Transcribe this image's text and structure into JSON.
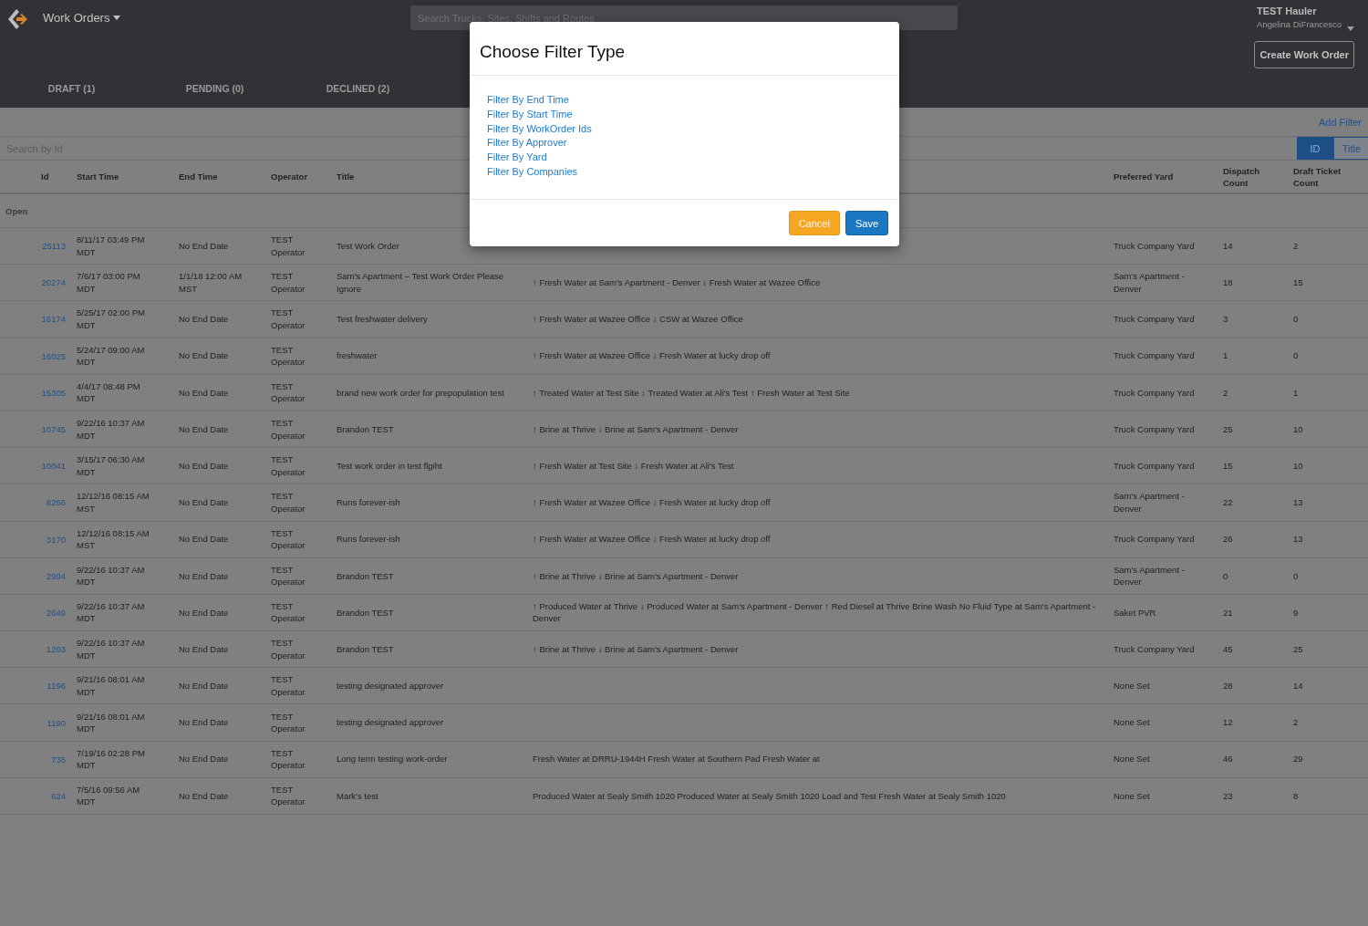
{
  "app": {
    "title": "Work Orders",
    "search_placeholder": "Search Trucks, Sites, Shifts and Routes",
    "company": "TEST Hauler",
    "user": "Angelina DiFrancesco",
    "create_button": "Create Work Order"
  },
  "tabs": [
    {
      "label": "DRAFT (1)",
      "selected": false
    },
    {
      "label": "PENDING (0)",
      "selected": false
    },
    {
      "label": "DECLINED (2)",
      "selected": false
    }
  ],
  "add_filter": "Add Filter",
  "search": {
    "placeholder": "Search by Id",
    "modes": [
      {
        "label": "ID",
        "selected": true
      },
      {
        "label": "Title",
        "selected": false
      }
    ]
  },
  "table": {
    "columns": [
      "Id",
      "Start Time",
      "End Time",
      "Operator",
      "Title",
      "Preferred Yard",
      "Dispatch Count",
      "Draft Ticket Count"
    ],
    "group": "Open",
    "rows": [
      {
        "id": "25113",
        "start": "8/11/17 03:49 PM MDT",
        "end": "No End Date",
        "operator": "TEST Operator",
        "title": "Test Work Order",
        "yard": "Truck Company Yard",
        "dispatch": "14",
        "draft": "2"
      },
      {
        "id": "20274",
        "start": "7/6/17 03:00 PM MDT",
        "end": "1/1/18 12:00 AM MST",
        "operator": "TEST Operator",
        "title": "Sam's Apartment – Test Work Order Please Ignore",
        "route": "↑ Fresh Water at Sam's Apartment - Denver ↓ Fresh Water at Wazee Office",
        "yard": "Sam's Apartment - Denver",
        "dispatch": "18",
        "draft": "15"
      },
      {
        "id": "16174",
        "start": "5/25/17 02:00 PM MDT",
        "end": "No End Date",
        "operator": "TEST Operator",
        "title": "Test freshwater delivery",
        "route": "↑ Fresh Water at Wazee Office ↓ CSW at Wazee Office",
        "yard": "Truck Company Yard",
        "dispatch": "3",
        "draft": "0"
      },
      {
        "id": "16025",
        "start": "5/24/17 09:00 AM MDT",
        "end": "No End Date",
        "operator": "TEST Operator",
        "title": "freshwater",
        "route": "↑ Fresh Water at Wazee Office ↓ Fresh Water at lucky drop off",
        "yard": "Truck Company Yard",
        "dispatch": "1",
        "draft": "0"
      },
      {
        "id": "15305",
        "start": "4/4/17 08:48 PM MDT",
        "end": "No End Date",
        "operator": "TEST Operator",
        "title": "brand new work order for prepopulation test",
        "route": "↑ Treated Water at Test Site ↓ Treated Water at Ali's Test ↑ Fresh Water at Test Site",
        "yard": "Truck Company Yard",
        "dispatch": "2",
        "draft": "1"
      },
      {
        "id": "10745",
        "start": "9/22/16 10:37 AM MDT",
        "end": "No End Date",
        "operator": "TEST Operator",
        "title": "Brandon TEST",
        "route": "↑ Brine at Thrive ↓ Brine at Sam's Apartment - Denver",
        "yard": "Truck Company Yard",
        "dispatch": "25",
        "draft": "10"
      },
      {
        "id": "10041",
        "start": "3/15/17 06:30 AM MDT",
        "end": "No End Date",
        "operator": "TEST Operator",
        "title": "Test work order in test flgiht",
        "route": "↑ Fresh Water at Test Site ↓ Fresh Water at Ali's Test",
        "yard": "Truck Company Yard",
        "dispatch": "15",
        "draft": "10"
      },
      {
        "id": "8266",
        "start": "12/12/16 08:15 AM MST",
        "end": "No End Date",
        "operator": "TEST Operator",
        "title": "Runs forever-ish",
        "route": "↑ Fresh Water at Wazee Office ↓ Fresh Water at lucky drop off",
        "yard": "Sam's Apartment - Denver",
        "dispatch": "22",
        "draft": "13"
      },
      {
        "id": "3170",
        "start": "12/12/16 08:15 AM MST",
        "end": "No End Date",
        "operator": "TEST Operator",
        "title": "Runs forever-ish",
        "route": "↑ Fresh Water at Wazee Office ↓ Fresh Water at lucky drop off",
        "yard": "Truck Company Yard",
        "dispatch": "26",
        "draft": "13"
      },
      {
        "id": "2994",
        "start": "9/22/16 10:37 AM MDT",
        "end": "No End Date",
        "operator": "TEST Operator",
        "title": "Brandon TEST",
        "route": "↑ Brine at Thrive ↓ Brine at Sam's Apartment - Denver",
        "yard": "Sam's Apartment - Denver",
        "dispatch": "0",
        "draft": "0"
      },
      {
        "id": "2649",
        "start": "9/22/16 10:37 AM MDT",
        "end": "No End Date",
        "operator": "TEST Operator",
        "title": "Brandon TEST",
        "route": "↑ Produced Water at Thrive ↓ Produced Water at Sam's Apartment - Denver ↑ Red Diesel at Thrive Brine Wash No Fluid Type at Sam's Apartment - Denver",
        "yard": "Saket PVR",
        "dispatch": "21",
        "draft": "9"
      },
      {
        "id": "1203",
        "start": "9/22/16 10:37 AM MDT",
        "end": "No End Date",
        "operator": "TEST Operator",
        "title": "Brandon TEST",
        "route": "↑ Brine at Thrive ↓ Brine at Sam's Apartment - Denver",
        "yard": "Truck Company Yard",
        "dispatch": "45",
        "draft": "25"
      },
      {
        "id": "1196",
        "start": "9/21/16 08:01 AM MDT",
        "end": "No End Date",
        "operator": "TEST Operator",
        "title": "testing designated approver",
        "yard": "None Set",
        "dispatch": "28",
        "draft": "14"
      },
      {
        "id": "1190",
        "start": "9/21/16 08:01 AM MDT",
        "end": "No End Date",
        "operator": "TEST Operator",
        "title": "testing designated approver",
        "yard": "None Set",
        "dispatch": "12",
        "draft": "2"
      },
      {
        "id": "735",
        "start": "7/19/16 02:28 PM MDT",
        "end": "No End Date",
        "operator": "TEST Operator",
        "title": "Long term testing work-order",
        "route": "Fresh Water at DRRU-1944H Fresh Water at Southern Pad Fresh Water at",
        "yard": "None Set",
        "dispatch": "46",
        "draft": "29"
      },
      {
        "id": "624",
        "start": "7/5/16 09:56 AM MDT",
        "end": "No End Date",
        "operator": "TEST Operator",
        "title": "Mark's test",
        "route": "Produced Water at Sealy Smith 1020 Produced Water at Sealy Smith 1020 Load and Test Fresh Water at Sealy Smith 1020",
        "yard": "None Set",
        "dispatch": "23",
        "draft": "8"
      }
    ]
  },
  "dialog": {
    "title": "Choose Filter Type",
    "options": [
      "Filter By End Time",
      "Filter By Start Time",
      "Filter By WorkOrder Ids",
      "Filter By Approver",
      "Filter By Yard",
      "Filter By Companies"
    ],
    "buttons": [
      {
        "label": "Cancel",
        "kind": "cancel"
      },
      {
        "label": "Save",
        "kind": "save"
      }
    ]
  }
}
